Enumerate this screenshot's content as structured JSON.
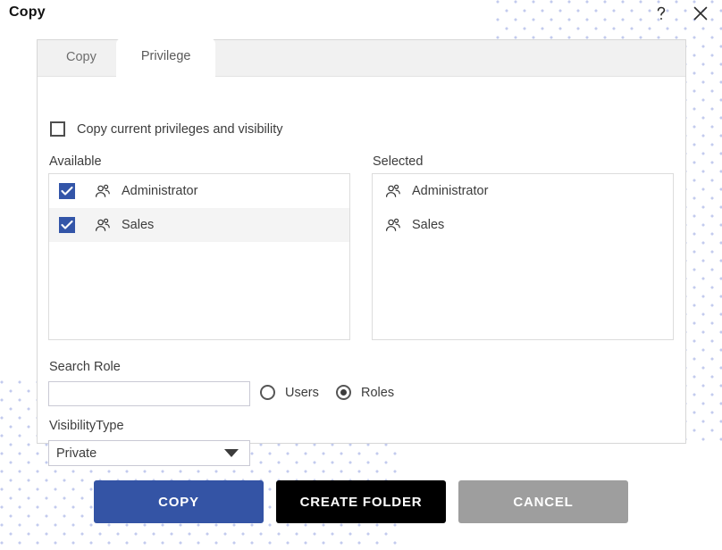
{
  "header": {
    "title": "Copy",
    "help_icon": "question-mark-icon",
    "close_icon": "close-icon"
  },
  "tabs": [
    {
      "label": "Copy",
      "active": false
    },
    {
      "label": "Privilege",
      "active": true
    }
  ],
  "panel": {
    "copy_privileges_checkbox": {
      "label": "Copy current privileges and visibility",
      "checked": false
    },
    "available": {
      "label": "Available",
      "items": [
        {
          "name": "Administrator",
          "checked": true,
          "highlighted": false,
          "icon": "group-icon"
        },
        {
          "name": "Sales",
          "checked": true,
          "highlighted": true,
          "icon": "group-icon"
        }
      ]
    },
    "selected": {
      "label": "Selected",
      "items": [
        {
          "name": "Administrator",
          "icon": "group-icon"
        },
        {
          "name": "Sales",
          "icon": "group-icon"
        }
      ]
    },
    "search_role": {
      "label": "Search Role",
      "value": "",
      "placeholder": ""
    },
    "search_scope": {
      "options": [
        {
          "label": "Users",
          "selected": false
        },
        {
          "label": "Roles",
          "selected": true
        }
      ]
    },
    "visibility_type": {
      "label": "VisibilityType",
      "value": "Private",
      "options": [
        "Private"
      ]
    }
  },
  "footer": {
    "copy_label": "COPY",
    "create_folder_label": "CREATE FOLDER",
    "cancel_label": "CANCEL"
  },
  "colors": {
    "accent_blue": "#3454a5",
    "checkbox_blue": "#3355a8",
    "black_button": "#000000",
    "cancel_gray": "#9e9e9e",
    "dot_pattern": "#c3cbee"
  }
}
